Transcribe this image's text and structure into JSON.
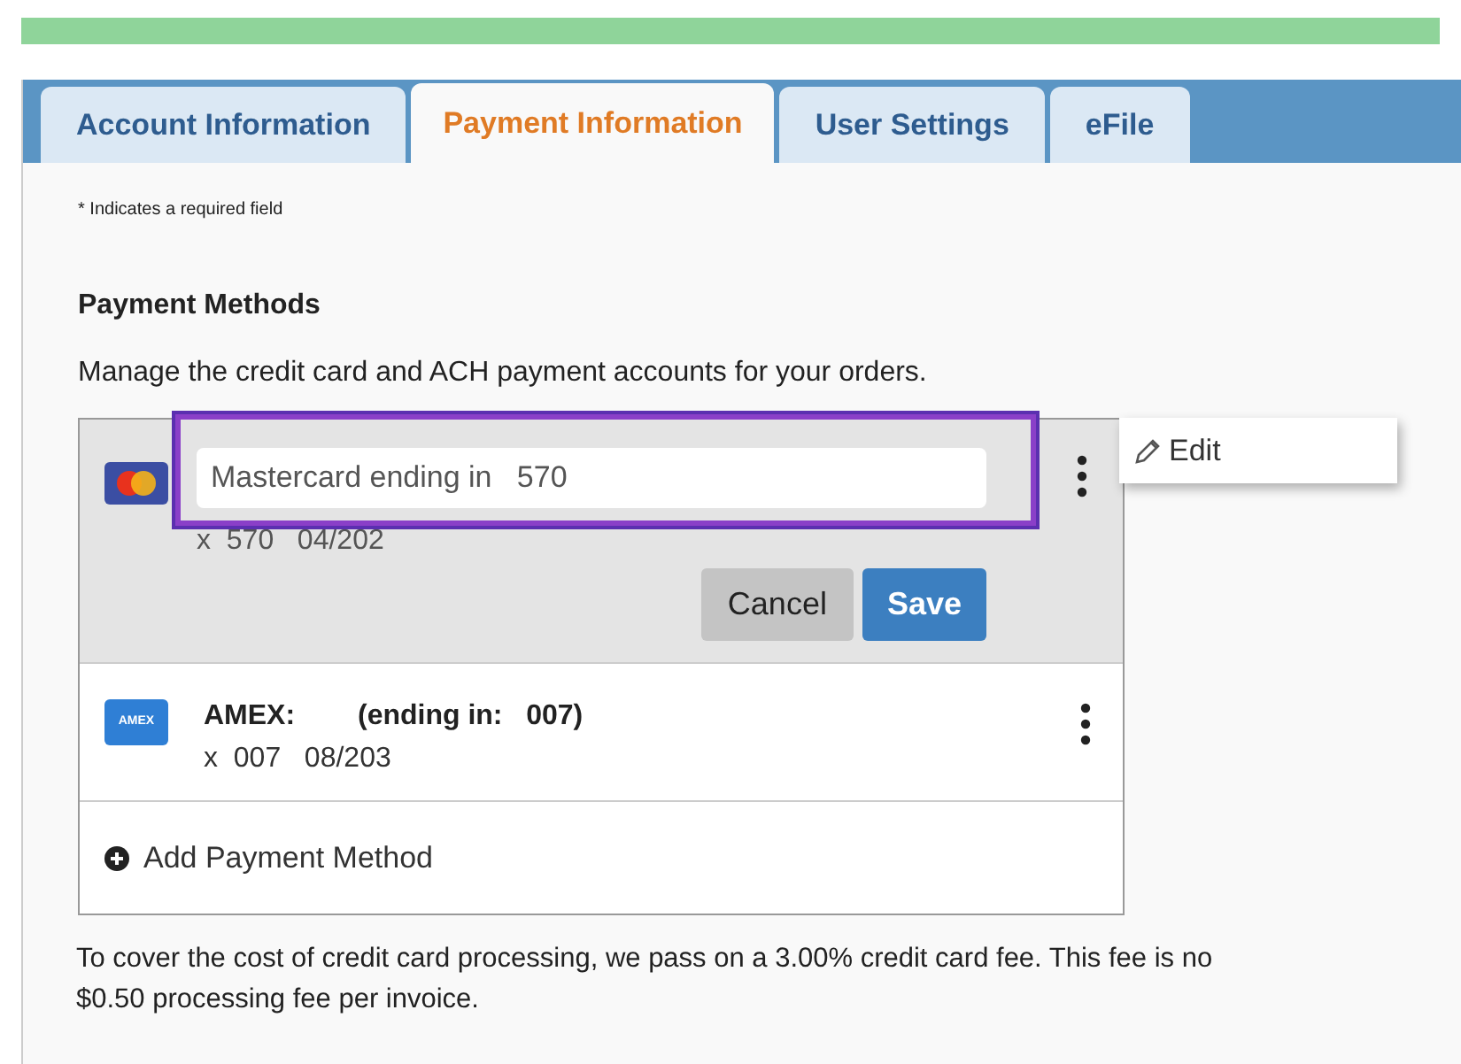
{
  "tabs": [
    {
      "label": "Account Information",
      "selected": false
    },
    {
      "label": "Payment Information",
      "selected": true
    },
    {
      "label": "User Settings",
      "selected": false
    },
    {
      "label": "eFile",
      "selected": false
    }
  ],
  "required_note": "* Indicates a required field",
  "section": {
    "title": "Payment Methods",
    "description": "Manage the credit card and ACH payment accounts for your orders."
  },
  "methods": [
    {
      "kind": "editing",
      "color": "#3b4ea3",
      "value": "Mastercard ending in   570",
      "detail": "x  570   04/202",
      "highlighted": true,
      "buttons": [
        {
          "label": "Cancel",
          "kind": "secondary"
        },
        {
          "label": "Save",
          "kind": "primary"
        }
      ]
    },
    {
      "kind": "view",
      "color": "#2f7fd5",
      "logo_text": "AMEX",
      "name": "AMEX:",
      "ending": "(ending in:   007)",
      "detail": "x  007   08/203"
    }
  ],
  "add_label": "Add Payment Method",
  "menu": {
    "items": [
      "Edit"
    ]
  },
  "footer_lines": [
    "To cover the cost of credit card processing, we pass on a 3.00% credit card fee. This fee is no",
    "$0.50 processing fee per invoice."
  ]
}
